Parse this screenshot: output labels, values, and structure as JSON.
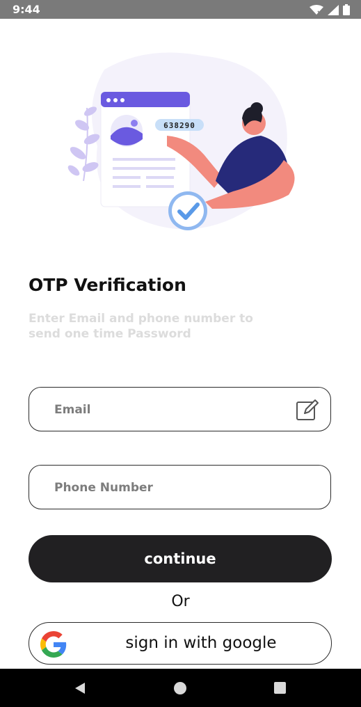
{
  "status_bar": {
    "time": "9:44",
    "icons": [
      "wifi-icon",
      "cell-signal-icon",
      "battery-icon"
    ]
  },
  "illustration": {
    "code": "638290"
  },
  "heading": {
    "title": "OTP Verification",
    "subtitle": "Enter Email and phone number to send one time Password"
  },
  "form": {
    "email": {
      "value": "",
      "placeholder": "Email"
    },
    "phone": {
      "value": "",
      "placeholder": "Phone Number"
    }
  },
  "buttons": {
    "continue_label": "continue",
    "or_text": "Or",
    "google_label": "sign in with google"
  },
  "colors": {
    "accent_purple": "#6a5ae0",
    "button_dark": "#212022",
    "subtitle_gray": "#dcdcdc"
  },
  "nav_bar": {
    "icons": [
      "back-icon",
      "home-icon",
      "recents-icon"
    ]
  }
}
